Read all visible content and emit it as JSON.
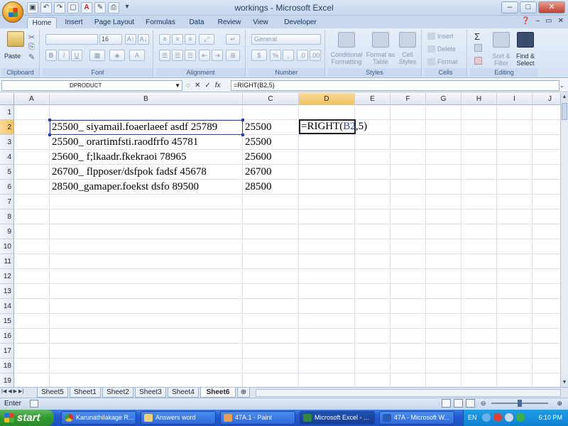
{
  "window": {
    "title": "workings - Microsoft Excel",
    "controls": [
      "–",
      "□",
      "✕"
    ]
  },
  "ribbon": {
    "tabs": [
      "Home",
      "Insert",
      "Page Layout",
      "Formulas",
      "Data",
      "Review",
      "View",
      "Developer"
    ],
    "active_tab": "Home",
    "clipboard": {
      "paste": "Paste",
      "label": "Clipboard"
    },
    "font": {
      "size": "16",
      "label": "Font",
      "bold": "B",
      "italic": "I",
      "underline": "U"
    },
    "alignment": {
      "label": "Alignment"
    },
    "number": {
      "format": "General",
      "label": "Number",
      "percent": "%",
      "comma": ","
    },
    "styles": {
      "conditional": "Conditional Formatting",
      "format_table": "Format as Table",
      "cell_styles": "Cell Styles",
      "label": "Styles"
    },
    "cells": {
      "insert": "Insert",
      "delete": "Delete",
      "format": "Format",
      "label": "Cells"
    },
    "editing": {
      "sigma": "Σ",
      "sort": "Sort & Filter",
      "find": "Find & Select",
      "label": "Editing"
    }
  },
  "formula_bar": {
    "name_box": "DPRODUCT",
    "cancel": "✕",
    "enter": "✓",
    "fx": "fx",
    "formula": "=RIGHT(B2,5)"
  },
  "columns": [
    "A",
    "B",
    "C",
    "D",
    "E",
    "F",
    "G",
    "H",
    "I",
    "J"
  ],
  "rows": [
    "1",
    "2",
    "3",
    "4",
    "5",
    "6",
    "7",
    "8",
    "9",
    "10",
    "11",
    "12",
    "13",
    "14",
    "15",
    "16",
    "17",
    "18",
    "19"
  ],
  "cells": {
    "B2": "25500_ siyamail.foaerlaeef asdf 25789",
    "B3": "25500_ orartimfsti.raodfrfo 45781",
    "B4": "25600_ f;lkaadr.fkekraoi 78965",
    "B5": "26700_ flpposer/dsfpok  fadsf 45678",
    "B6": "28500_gamaper.foekst dsfo 89500",
    "C2": "25500",
    "C3": "25500",
    "C4": "25600",
    "C5": "26700",
    "C6": "28500"
  },
  "editing_cell": {
    "prefix": "=RIGHT(",
    "ref": "B2",
    "suffix": ",5)"
  },
  "sheets": [
    "Sheet5",
    "Sheet1",
    "Sheet2",
    "Sheet3",
    "Sheet4",
    "Sheet6"
  ],
  "active_sheet": "Sheet6",
  "status": {
    "mode": "Enter"
  },
  "taskbar": {
    "start": "start",
    "items": [
      "Karunathilakage R...",
      "Answers word",
      "47A.1 - Paint",
      "Microsoft Excel - ...",
      "47A - Microsoft W..."
    ],
    "active_index": 3,
    "lang": "EN",
    "clock": "6:10 PM"
  }
}
